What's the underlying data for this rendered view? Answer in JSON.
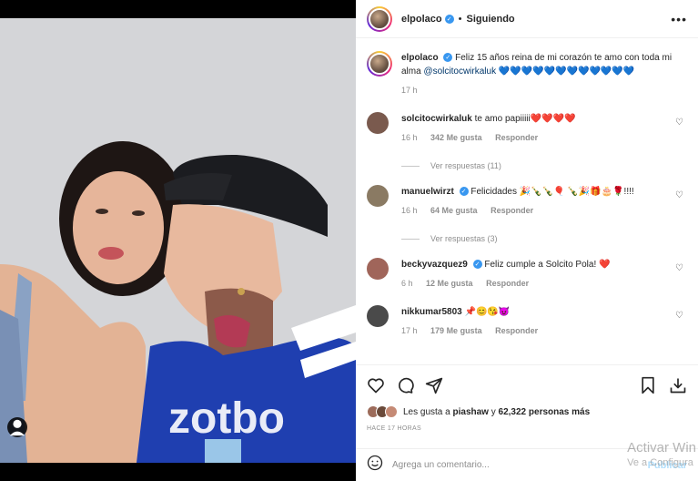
{
  "post": {
    "username": "elpolaco",
    "follow_status": "Siguiendo",
    "more_label": "•••"
  },
  "caption": {
    "username": "elpolaco",
    "text": "Feliz 15 años reina de mi corazón te amo con toda mi alma",
    "mention": "@solcitocwirkaluk",
    "emoji": "💙💙💙💙💙💙💙💙💙💙💙💙",
    "time": "17 h"
  },
  "comments": [
    {
      "username": "solcitocwirkaluk",
      "verified": false,
      "text": "te amo papiiiii❤️❤️❤️❤️",
      "time": "16 h",
      "likes": "342 Me gusta",
      "reply": "Responder",
      "replies": "Ver respuestas (11)",
      "avatar_color": "#7a5a4e"
    },
    {
      "username": "manuelwirzt",
      "verified": true,
      "text": "Felicidades 🎉🍾🍾🎈 🍾🎉🎁🎂🌹!!!!",
      "time": "16 h",
      "likes": "64 Me gusta",
      "reply": "Responder",
      "replies": "Ver respuestas (3)",
      "avatar_color": "#8a7a63"
    },
    {
      "username": "beckyvazquez9",
      "verified": true,
      "text": "Feliz cumple a Solcito Pola! ❤️",
      "time": "6 h",
      "likes": "12 Me gusta",
      "reply": "Responder",
      "replies": "",
      "avatar_color": "#a0655a"
    },
    {
      "username": "nikkumar5803",
      "verified": false,
      "text": "📌😊😘😈",
      "time": "17 h",
      "likes": "179 Me gusta",
      "reply": "Responder",
      "replies": "",
      "avatar_color": "#4a4a4a"
    }
  ],
  "likes": {
    "prefix": "Les gusta a",
    "user": "piashaw",
    "suffix": "y",
    "others": "62,322 personas más"
  },
  "timestamp": "HACE 17 HORAS",
  "comment_input": {
    "placeholder": "Agrega un comentario...",
    "publish": "Publicar"
  },
  "watermark": {
    "line1": "Activar Win",
    "line2": "Ve a Configura"
  },
  "colors": {
    "link": "#00376b",
    "meta": "#8e8e8e",
    "verified": "#3897f0",
    "jersey": "#1f3fb0"
  },
  "icons": [
    "heart-icon",
    "comment-icon",
    "share-icon",
    "bookmark-icon",
    "download-icon",
    "emoji-icon",
    "user-tag-icon",
    "more-icon"
  ]
}
